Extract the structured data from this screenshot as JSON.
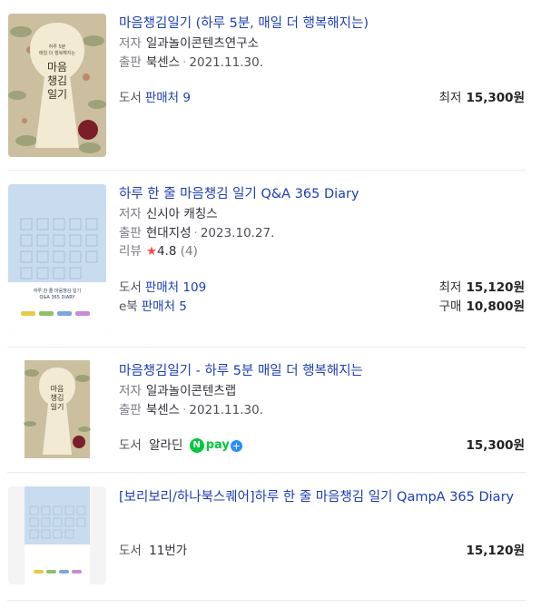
{
  "results": [
    {
      "title": "마음챙김일기 (하루 5분, 매일 더 행복해지는)",
      "author_label": "저자",
      "author": "일과놀이콘텐츠연구소",
      "publisher_label": "출판",
      "publisher": "북센스",
      "date": "2021.11.30.",
      "cover_text": [
        "하루 5분",
        "매일 더 행복해지는",
        "마음",
        "챙김",
        "일기"
      ],
      "store_label": "도서",
      "sellers_text": "판매처 9",
      "price_prefix": "최저",
      "price": "15,300원"
    },
    {
      "title": "하루 한 줄 마음챙김 일기 Q&A 365 Diary",
      "author_label": "저자",
      "author": "신시아 캐칭스",
      "publisher_label": "출판",
      "publisher": "현대지성",
      "date": "2023.10.27.",
      "review_label": "리뷰",
      "rating": "4.8",
      "review_count": "(4)",
      "cover_text": [
        "하루 한 줄 마음챙김 일기",
        "Q&A 365 DIARY"
      ],
      "store_label": "도서",
      "sellers_text": "판매처 109",
      "price_prefix": "최저",
      "price": "15,120원",
      "ebook_label": "e북",
      "ebook_sellers_text": "판매처 5",
      "ebook_price_prefix": "구매",
      "ebook_price": "10,800원"
    },
    {
      "title": "마음챙김일기 - 하루 5분 매일 더 행복해지는",
      "author_label": "저자",
      "author": "일과놀이콘텐츠랩",
      "publisher_label": "출판",
      "publisher": "북센스",
      "date": "2021.11.30.",
      "cover_text": [
        "마음",
        "챙김",
        "일기"
      ],
      "store_label": "도서",
      "seller": "알라딘",
      "npay_icon": "naver-pay-plus-icon",
      "npay_text": "pay",
      "price": "15,300원"
    },
    {
      "title": "[보리보리/하나북스퀘어]하루 한 줄 마음챙김 일기 QampA 365 Diary",
      "store_label": "도서",
      "seller": "11번가",
      "price": "15,120원"
    }
  ],
  "colors": {
    "link": "#1b3fb8",
    "star": "#ff4b4b",
    "npay_green": "#00c73c",
    "npay_blue": "#2a8cff"
  }
}
